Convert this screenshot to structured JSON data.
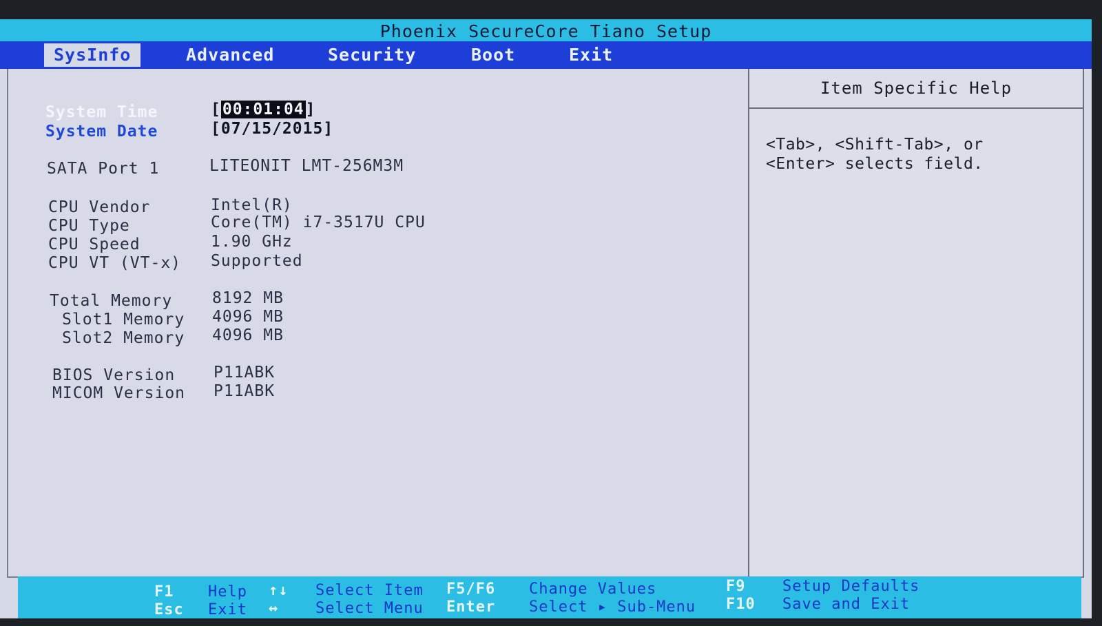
{
  "title": "Phoenix SecureCore Tiano Setup",
  "menu": [
    {
      "label": "SysInfo",
      "active": true
    },
    {
      "label": "Advanced"
    },
    {
      "label": "Security"
    },
    {
      "label": "Boot"
    },
    {
      "label": "Exit"
    }
  ],
  "sysinfo": {
    "system_time_label": "System Time",
    "system_time_value": "00:01:04",
    "system_date_label": "System Date",
    "system_date_value": "[07/15/2015]",
    "sata_label": "SATA Port 1",
    "sata_value": "LITEONIT LMT-256M3M",
    "cpu_vendor_label": "CPU Vendor",
    "cpu_vendor_value": "Intel(R)",
    "cpu_type_label": "CPU Type",
    "cpu_type_value": "Core(TM) i7-3517U CPU",
    "cpu_speed_label": "CPU Speed",
    "cpu_speed_value": "1.90 GHz",
    "cpu_vt_label": "CPU VT (VT-x)",
    "cpu_vt_value": "Supported",
    "total_memory_label": "Total Memory",
    "total_memory_value": "8192 MB",
    "slot1_label": "Slot1 Memory",
    "slot1_value": "4096 MB",
    "slot2_label": "Slot2 Memory",
    "slot2_value": "4096 MB",
    "bios_label": "BIOS Version",
    "bios_value": "P11ABK",
    "micom_label": "MICOM Version",
    "micom_value": "P11ABK"
  },
  "help": {
    "header": "Item Specific Help",
    "line1": "<Tab>, <Shift-Tab>, or",
    "line2": "<Enter> selects field."
  },
  "footer": {
    "f1_key": "F1",
    "f1_label": "Help",
    "esc_key": "Esc",
    "esc_label": "Exit",
    "updown_key": "↑↓",
    "updown_label": "Select Item",
    "leftright_key": "↔",
    "leftright_label": "Select Menu",
    "f5f6_key": "F5/F6",
    "f5f6_label": "Change Values",
    "enter_key": "Enter",
    "enter_label": "Select ▸ Sub-Menu",
    "f9_key": "F9",
    "f9_label": "Setup Defaults",
    "f10_key": "F10",
    "f10_label": "Save and Exit"
  }
}
